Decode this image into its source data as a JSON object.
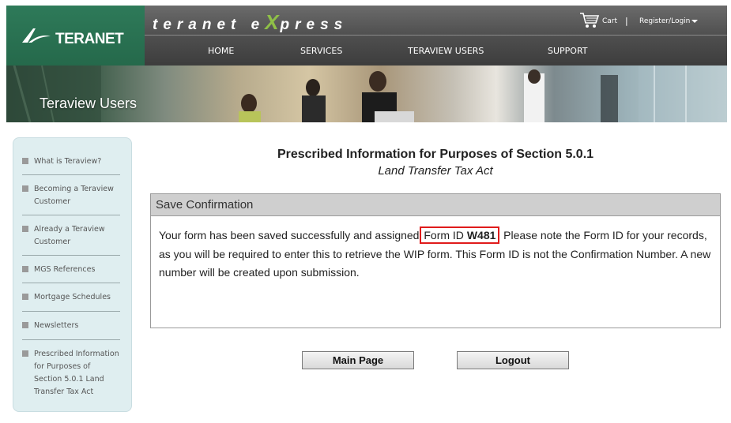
{
  "logo": {
    "text": "TERANET",
    "mark_icon": "teranet-swoosh-logo"
  },
  "brand": {
    "part1": "teranet e",
    "x_letter": "X",
    "part2": "press"
  },
  "utility": {
    "cart_label": "Cart",
    "separator": "|",
    "register_label": "Register/Login"
  },
  "nav": {
    "items": [
      "HOME",
      "SERVICES",
      "TERAVIEW USERS",
      "SUPPORT"
    ]
  },
  "banner": {
    "title": "Teraview Users"
  },
  "sidebar": {
    "items": [
      "What is Teraview?",
      "Becoming a Teraview Customer",
      "Already a Teraview Customer",
      "MGS References",
      "Mortgage Schedules",
      "Newsletters",
      "Prescribed Information for Purposes of Section 5.0.1 Land Transfer Tax Act"
    ]
  },
  "main": {
    "title": "Prescribed Information for Purposes of Section 5.0.1",
    "subtitle": "Land Transfer Tax Act",
    "panel": {
      "header": "Save Confirmation",
      "text_before": "Your form has been saved successfully and assigned ",
      "form_id_label": "Form ID ",
      "form_id_value": "W481",
      "text_after": ". Please note the Form ID for your records, as you will be required to enter this to retrieve the WIP form. This Form ID is not the Confirmation Number. A new number will be created upon submission."
    },
    "buttons": {
      "main_page": "Main Page",
      "logout": "Logout"
    }
  },
  "colors": {
    "logo_green": "#2e7a59",
    "brand_x_green": "#8fc047",
    "highlight_red": "#e01b1b",
    "sidebar_bg": "#dfeef0"
  }
}
